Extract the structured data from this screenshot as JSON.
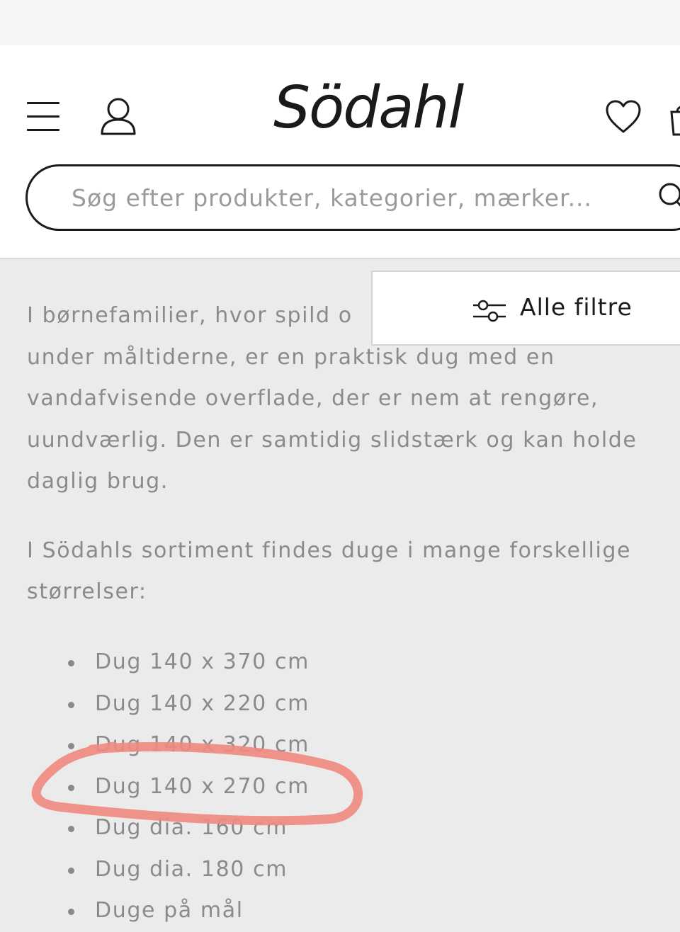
{
  "header": {
    "logo_text": "Södahl",
    "search_placeholder": "Søg efter produkter, kategorier, mærker..."
  },
  "filter": {
    "label": "Alle filtre"
  },
  "content": {
    "paragraph1_lines": [
      "I børnefamilier, hvor spild o",
      "under måltiderne, er en praktisk dug med en",
      "vandafvisende overflade, der er nem at rengøre,",
      "uundværlig. Den er samtidig slidstærk og kan holde",
      "daglig brug."
    ],
    "paragraph2_lines": [
      "I Södahls sortiment findes duge i mange forskellige",
      "størrelser:"
    ],
    "sizes": [
      "Dug 140 x 370 cm",
      "Dug 140 x 220 cm",
      "Dug 140 x 320 cm",
      "Dug 140 x 270 cm",
      "Dug dia. 160 cm",
      "Dug dia. 180 cm",
      "Duge på mål"
    ]
  },
  "colors": {
    "highlight": "#f08a80",
    "text": "#8a8a8a",
    "background": "#ebebeb"
  }
}
